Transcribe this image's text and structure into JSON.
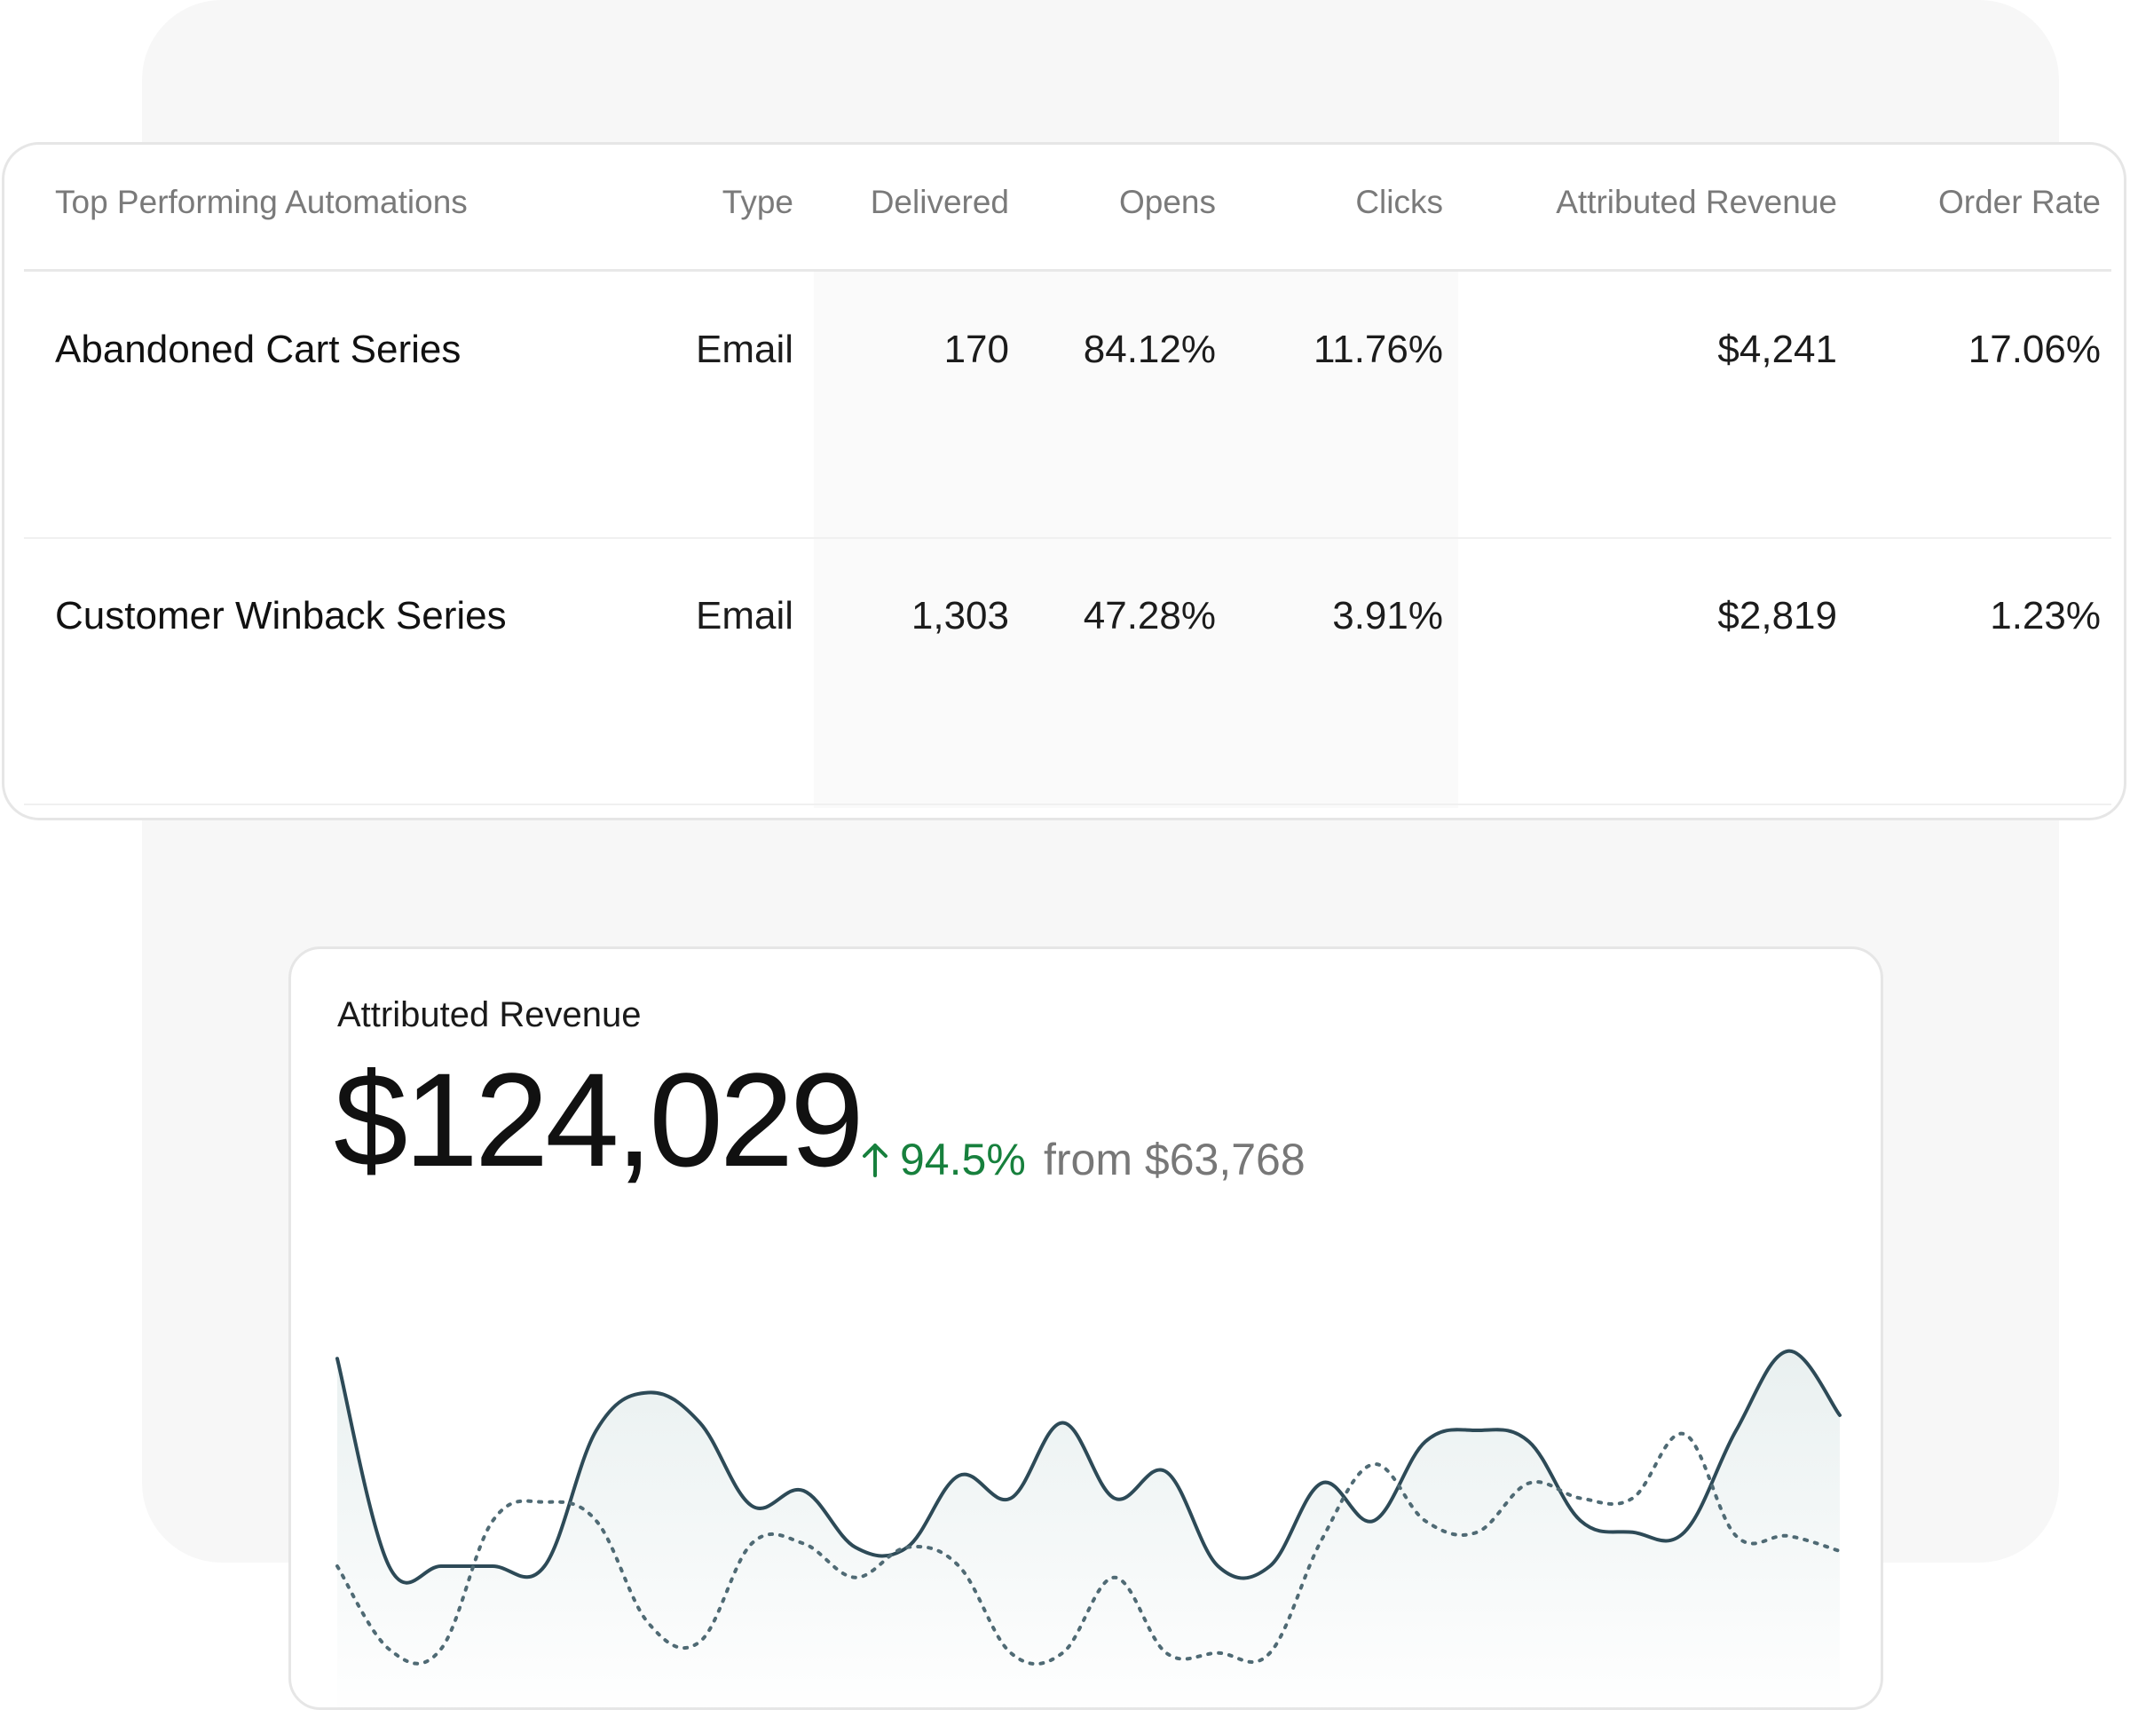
{
  "table": {
    "headers": [
      "Top Performing Automations",
      "Type",
      "Delivered",
      "Opens",
      "Clicks",
      "Attributed Revenue",
      "Order Rate"
    ],
    "rows": [
      {
        "name": "Abandoned Cart Series",
        "type": "Email",
        "delivered": "170",
        "opens": "84.12%",
        "clicks": "11.76%",
        "revenue": "$4,241",
        "order_rate": "17.06%"
      },
      {
        "name": "Customer Winback Series",
        "type": "Email",
        "delivered": "1,303",
        "opens": "47.28%",
        "clicks": "3.91%",
        "revenue": "$2,819",
        "order_rate": "1.23%"
      }
    ]
  },
  "revenue_card": {
    "title": "Attributed Revenue",
    "value": "$124,029",
    "change": "94.5%",
    "from_text": "from $63,768",
    "change_color": "#17803d",
    "arrow_icon": "arrow-up-icon"
  },
  "chart_data": {
    "type": "line",
    "x": [
      0,
      1,
      2,
      3,
      4,
      5,
      6,
      7,
      8,
      9,
      10,
      11,
      12,
      13,
      14,
      15,
      16,
      17,
      18,
      19,
      20,
      21,
      22,
      23,
      24,
      25,
      26,
      27,
      28,
      29
    ],
    "series": [
      {
        "style": "solid",
        "color": "#2d4a57",
        "values": [
          0.95,
          0.4,
          0.4,
          0.4,
          0.4,
          0.76,
          0.86,
          0.78,
          0.56,
          0.6,
          0.45,
          0.45,
          0.64,
          0.58,
          0.78,
          0.58,
          0.65,
          0.4,
          0.4,
          0.62,
          0.52,
          0.73,
          0.76,
          0.73,
          0.52,
          0.49,
          0.49,
          0.76,
          0.97,
          0.8
        ]
      },
      {
        "style": "dotted",
        "color": "#4f6a74",
        "values": [
          0.4,
          0.18,
          0.18,
          0.52,
          0.57,
          0.52,
          0.25,
          0.2,
          0.46,
          0.46,
          0.37,
          0.45,
          0.4,
          0.17,
          0.17,
          0.37,
          0.17,
          0.17,
          0.17,
          0.47,
          0.67,
          0.52,
          0.49,
          0.62,
          0.58,
          0.58,
          0.75,
          0.48,
          0.48,
          0.44
        ]
      }
    ],
    "fill_color": "#e9f0f0",
    "ylim": [
      0,
      1
    ],
    "grid": false
  }
}
